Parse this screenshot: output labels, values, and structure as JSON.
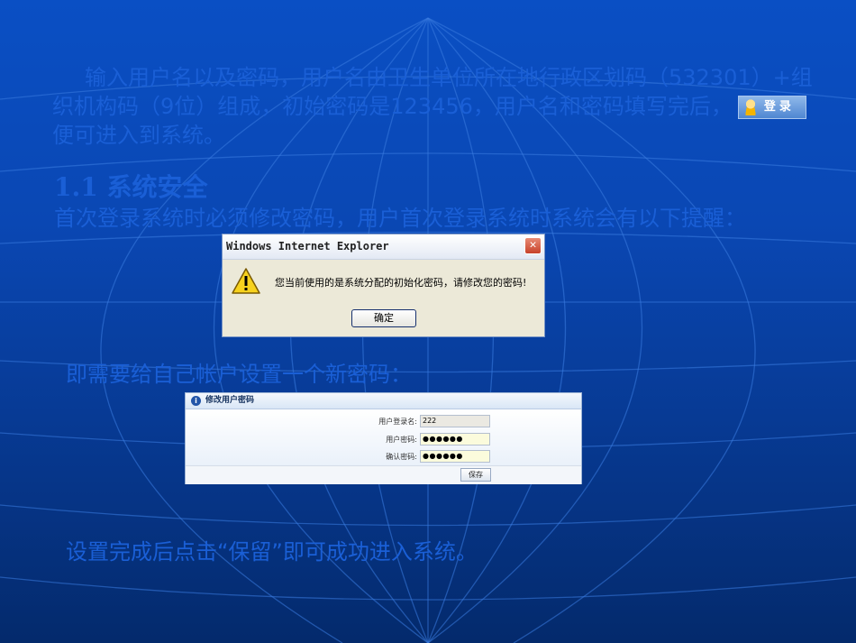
{
  "slide": {
    "paragraph_before": "输入用户名以及密码，用户名由卫生单位所在地行政区划码（532301）+组织机构码（9位）组成，初始密码是123456，用户名和密码填写完后，",
    "login_button_label": "登录",
    "paragraph_after": "便可进入到系统。",
    "heading": "1.1 系统安全",
    "line_first_login": "首次登录系统时必须修改密码，用户首次登录系统时系统会有以下提醒：",
    "line_set_password": "即需要给自己帐户设置一个新密码：",
    "line_after_save": "设置完成后点击“保留”即可成功进入系统。"
  },
  "dialog": {
    "title": "Windows Internet Explorer",
    "close_glyph": "✕",
    "message": "您当前使用的是系统分配的初始化密码，请修改您的密码!",
    "ok_label": "确定",
    "icon": "warning-icon"
  },
  "password_panel": {
    "title": "修改用户密码",
    "info_glyph": "i",
    "username_label": "用户登录名:",
    "username_value": "222",
    "password_label": "用户密码:",
    "password_value": "●●●●●●",
    "confirm_label": "确认密码:",
    "confirm_value": "●●●●●●",
    "save_label": "保存"
  },
  "colors": {
    "background_top": "#0a4fc4",
    "background_bottom": "#042a6c",
    "text": "#1a5fd6"
  }
}
